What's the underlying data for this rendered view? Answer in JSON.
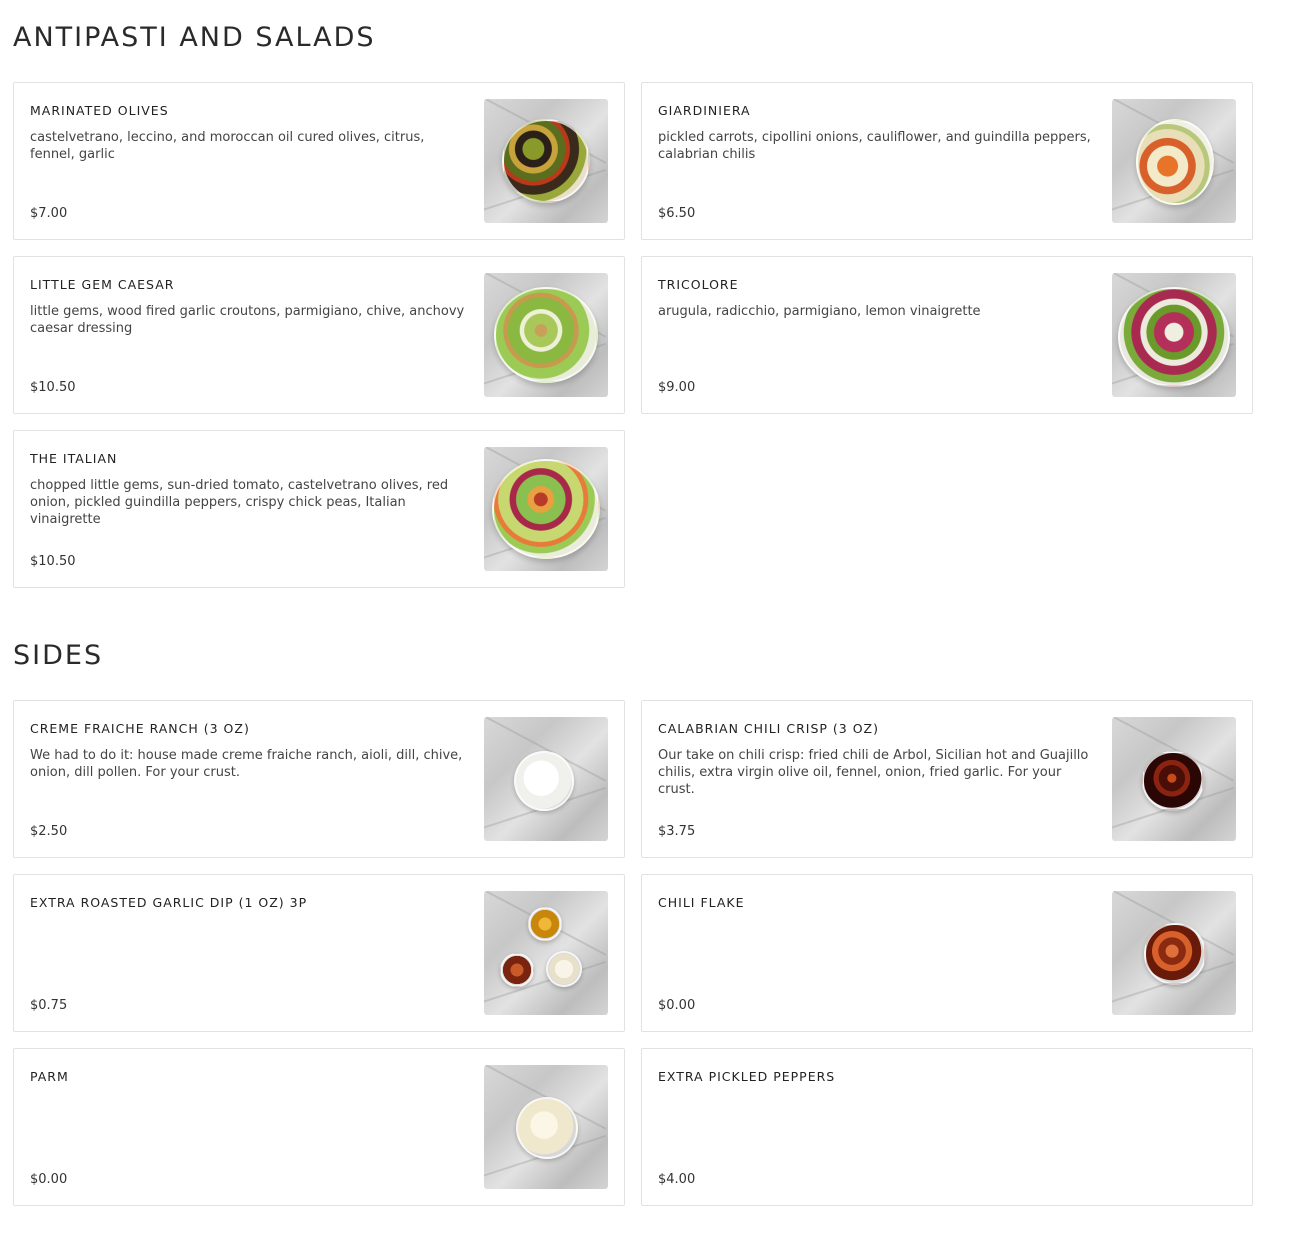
{
  "sections": [
    {
      "title": "ANTIPASTI AND SALADS",
      "items": [
        {
          "name": "MARINATED OLIVES",
          "description": "castelvetrano, leccino, and moroccan oil cured olives, citrus, fennel, garlic",
          "price": "$7.00",
          "image": "marinated-olives-photo"
        },
        {
          "name": "GIARDINIERA",
          "description": "pickled carrots, cipollini onions, cauliflower, and guindilla peppers, calabrian chilis",
          "price": "$6.50",
          "image": "giardiniera-photo"
        },
        {
          "name": "LITTLE GEM CAESAR",
          "description": "little gems, wood fired garlic croutons, parmigiano, chive, anchovy caesar dressing",
          "price": "$10.50",
          "image": "little-gem-caesar-photo"
        },
        {
          "name": "TRICOLORE",
          "description": "arugula, radicchio, parmigiano, lemon vinaigrette",
          "price": "$9.00",
          "image": "tricolore-photo"
        },
        {
          "name": "THE ITALIAN",
          "description": "chopped little gems, sun-dried tomato, castelvetrano olives, red onion, pickled guindilla peppers, crispy chick peas, Italian vinaigrette",
          "price": "$10.50",
          "image": "the-italian-photo"
        }
      ]
    },
    {
      "title": "SIDES",
      "items": [
        {
          "name": "CREME FRAICHE RANCH (3 OZ)",
          "description": "We had to do it: house made creme fraiche ranch, aioli, dill, chive, onion, dill pollen. For your crust.",
          "price": "$2.50",
          "image": "ranch-photo"
        },
        {
          "name": "CALABRIAN CHILI CRISP (3 OZ)",
          "description": "Our take on chili crisp: fried chili de Arbol, Sicilian hot and Guajillo chilis, extra virgin olive oil, fennel, onion, fried garlic. For your crust.",
          "price": "$3.75",
          "image": "chili-crisp-photo"
        },
        {
          "name": "EXTRA ROASTED GARLIC DIP (1 OZ) 3P",
          "description": "",
          "price": "$0.75",
          "image": "garlic-dip-photo"
        },
        {
          "name": "CHILI FLAKE",
          "description": "",
          "price": "$0.00",
          "image": "chili-flake-photo"
        },
        {
          "name": "PARM",
          "description": "",
          "price": "$0.00",
          "image": "parm-photo"
        },
        {
          "name": "EXTRA PICKLED PEPPERS",
          "description": "",
          "price": "$4.00",
          "image": ""
        }
      ]
    }
  ]
}
